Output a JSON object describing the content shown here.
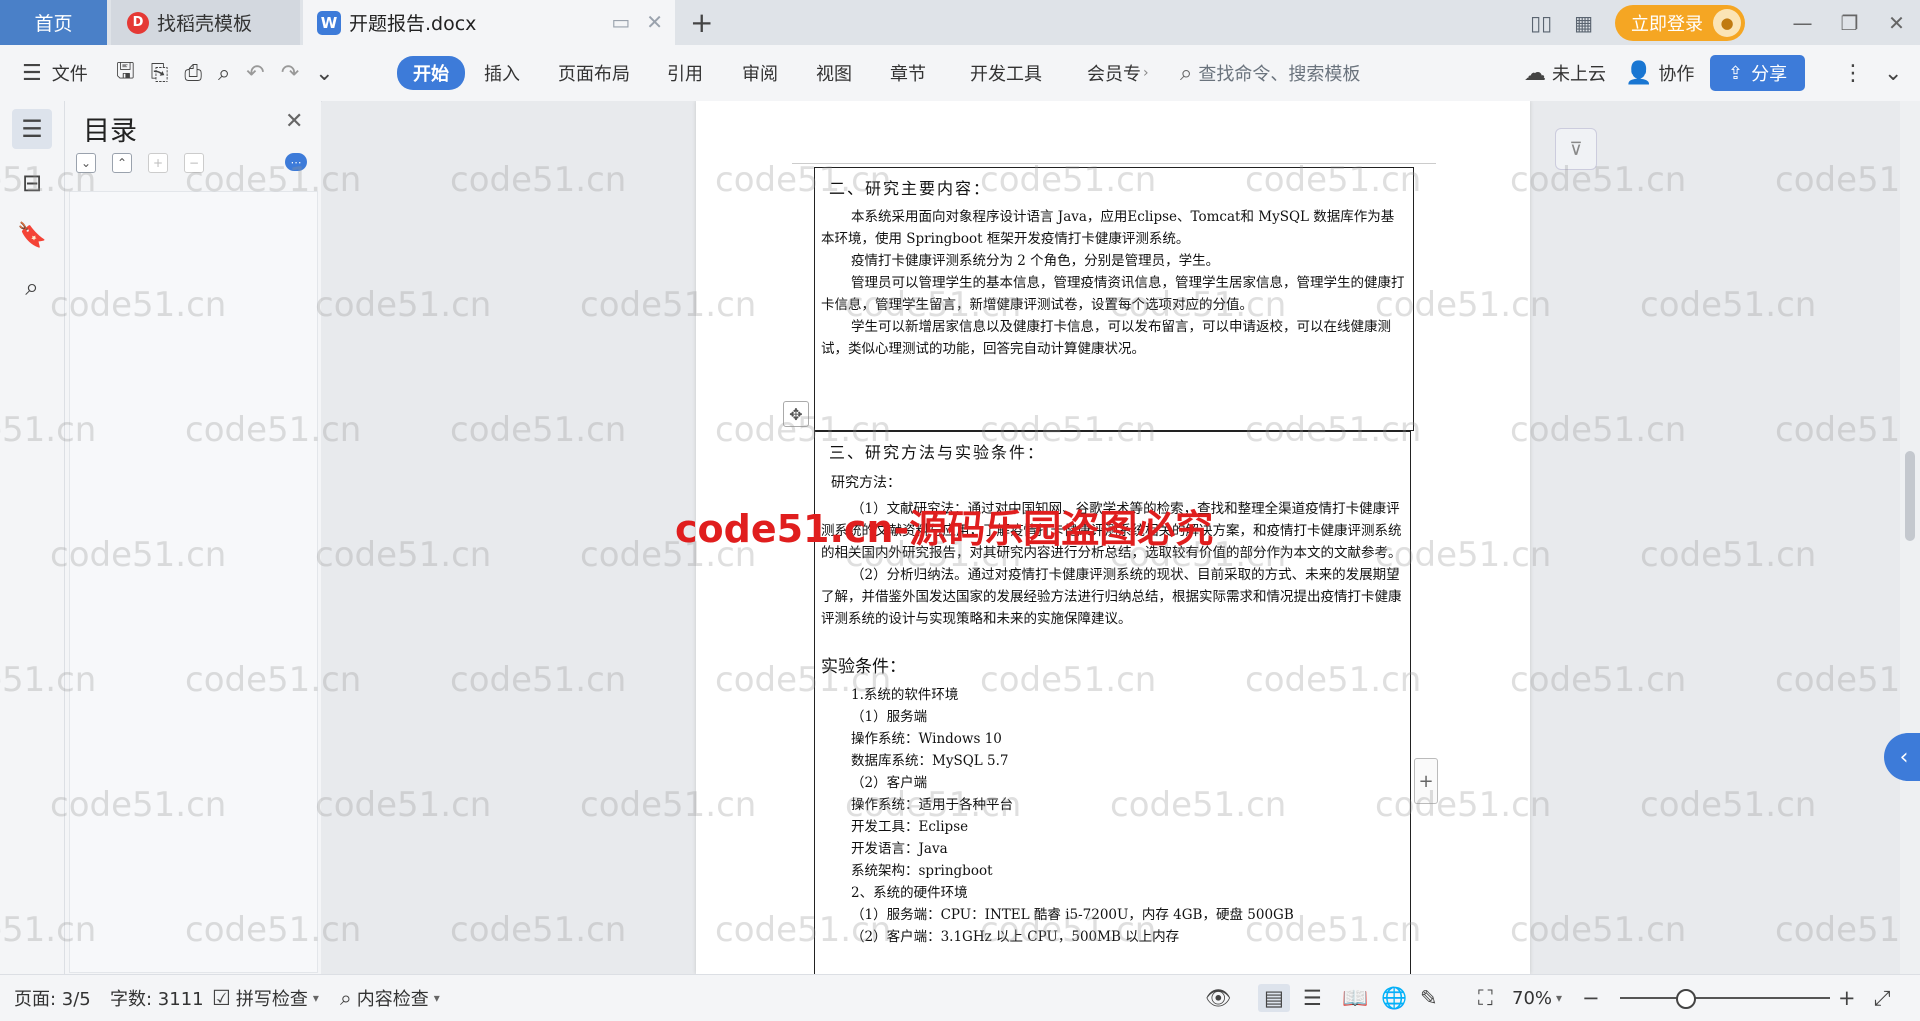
{
  "tabs": {
    "home": "首页",
    "templates": "找稻壳模板",
    "doc": "开题报告.docx",
    "add": "+"
  },
  "titlebar": {
    "login": "立即登录"
  },
  "ribbon": {
    "file": "文件",
    "menus": [
      "开始",
      "插入",
      "页面布局",
      "引用",
      "审阅",
      "视图",
      "章节",
      "开发工具",
      "会员专"
    ],
    "search_placeholder": "查找命令、搜索模板",
    "cloud": "未上云",
    "collab": "协作",
    "share": "分享"
  },
  "toc": {
    "title": "目录"
  },
  "document": {
    "section2_title": "二、研究主要内容：",
    "section2_paragraphs": [
      "本系统采用面向对象程序设计语言 Java，应用Eclipse、Tomcat和 MySQL 数据库作为基本环境，使用 Springboot 框架开发疫情打卡健康评测系统。",
      "疫情打卡健康评测系统分为 2 个角色，分别是管理员，学生。",
      "管理员可以管理学生的基本信息，管理疫情资讯信息，管理学生居家信息，管理学生的健康打卡信息，管理学生留言，新增健康评测试卷，设置每个选项对应的分值。",
      "学生可以新增居家信息以及健康打卡信息，可以发布留言，可以申请返校，可以在线健康测试，类似心理测试的功能，回答完自动计算健康状况。"
    ],
    "section3_title": "三、研究方法与实验条件：",
    "methods_title": "研究方法：",
    "methods_paragraphs": [
      "（1）文献研究法：通过对中国知网、谷歌学术等的检索，查找和整理全渠道疫情打卡健康评测系统的文献资料与应用，了解疫情打卡健康评测系统相关的解决方案，和疫情打卡健康评测系统的相关国内外研究报告，对其研究内容进行分析总结，选取较有价值的部分作为本文的文献参考。",
      "（2）分析归纳法。通过对疫情打卡健康评测系统的现状、目前采取的方式、未来的发展期望了解，并借鉴外国发达国家的发展经验方法进行归纳总结，根据实际需求和情况提出疫情打卡健康评测系统的设计与实现策略和未来的实施保障建议。"
    ],
    "conditions_title": "实验条件：",
    "conditions_lines": [
      "1.系统的软件环境",
      "（1）服务端",
      "操作系统：Windows 10",
      "数据库系统：MySQL 5.7",
      "（2）客户端",
      "操作系统：适用于各种平台",
      "开发工具：Eclipse",
      "开发语言：Java",
      "系统架构：springboot",
      "2、系统的硬件环境",
      "（1）服务端：CPU：INTEL 酷睿 i5-7200U，内存 4GB，硬盘 500GB",
      "（2）客户端：3.1GHz 以上 CPU，500MB 以上内存"
    ]
  },
  "watermark": {
    "text": "code51.cn",
    "center_text": "code51.cn-源码乐园盗图必究"
  },
  "statusbar": {
    "page": "页面: 3/5",
    "words": "字数: 3111",
    "spellcheck": "拼写检查",
    "content_check": "内容检查",
    "zoom": "70%"
  }
}
